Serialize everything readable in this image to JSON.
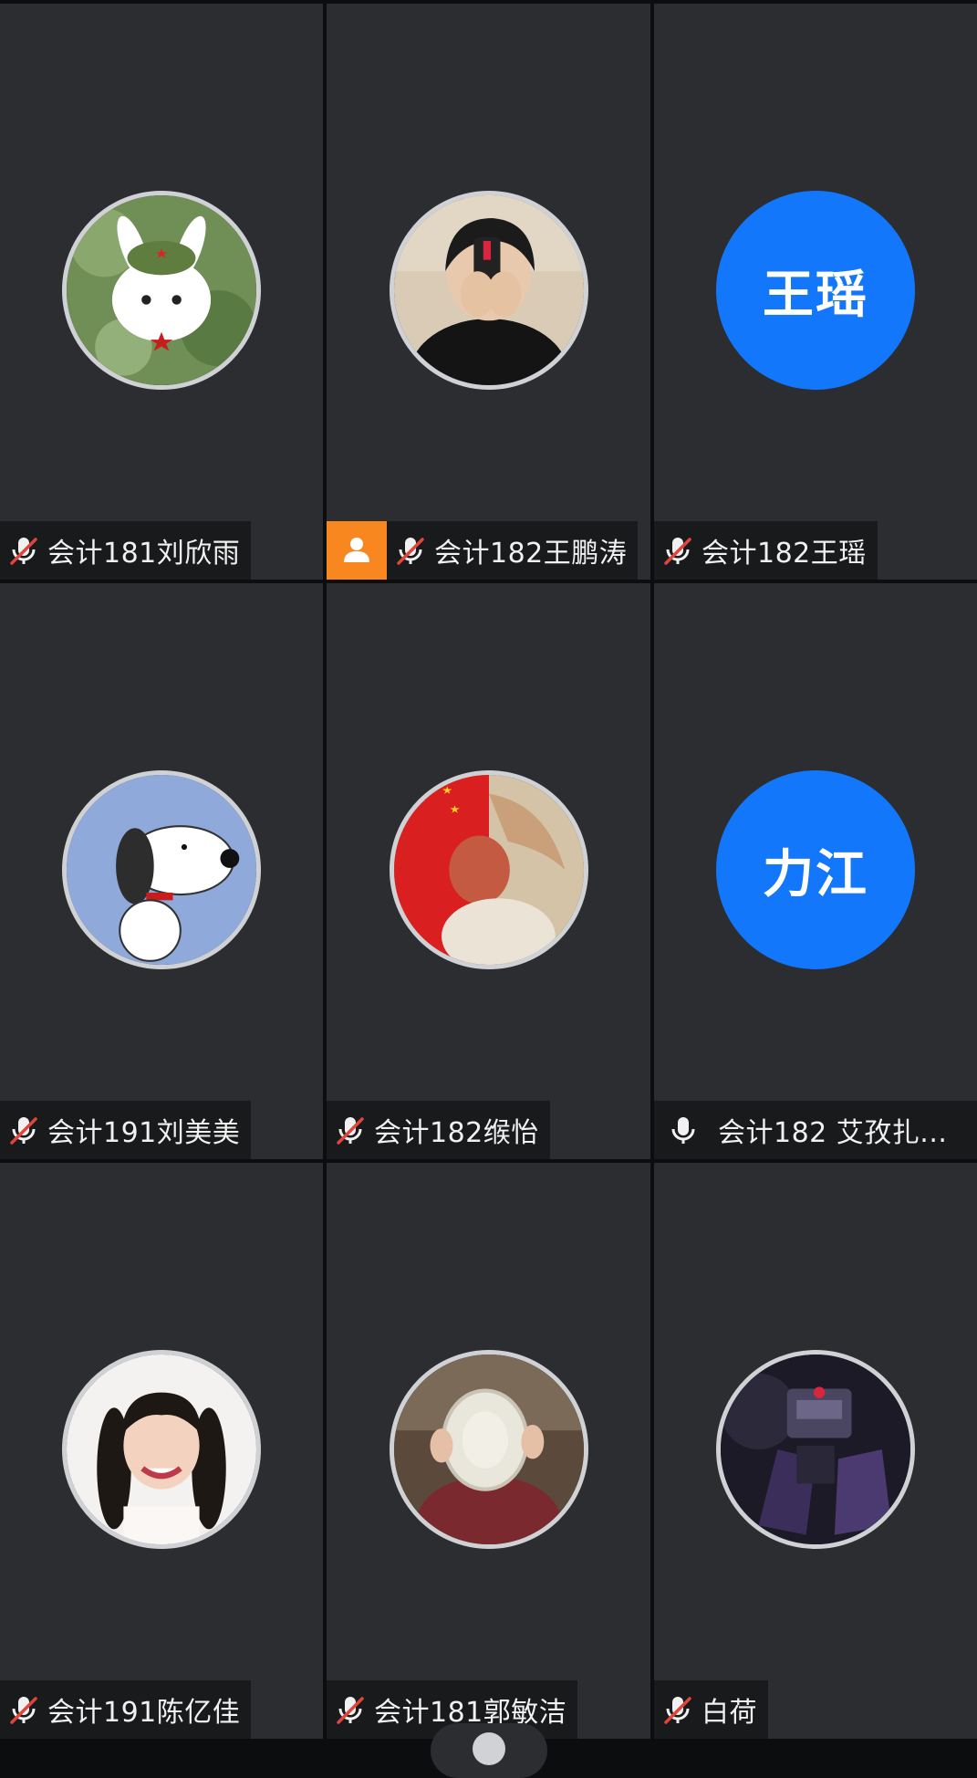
{
  "participants": [
    {
      "name": "会计181刘欣雨",
      "muted": true,
      "avatar": "cartoon-rabbit"
    },
    {
      "name": "会计182王鹏涛",
      "muted": true,
      "avatar": "photo-boy",
      "host": true
    },
    {
      "name": "会计182王瑶",
      "muted": true,
      "avatar_text": "王瑶"
    },
    {
      "name": "会计191刘美美",
      "muted": true,
      "avatar": "snoopy"
    },
    {
      "name": "会计182缑怡",
      "muted": true,
      "avatar": "flag-girl"
    },
    {
      "name": "会计182 艾孜扎...",
      "muted": false,
      "avatar_text": "力江"
    },
    {
      "name": "会计191陈亿佳",
      "muted": true,
      "avatar": "photo-girl"
    },
    {
      "name": "会计181郭敏洁",
      "muted": true,
      "avatar": "child-plate"
    },
    {
      "name": "白荷",
      "muted": true,
      "avatar": "robot"
    }
  ],
  "colors": {
    "tile_bg": "#2b2d31",
    "text_avatar_bg": "#1277fb",
    "host_badge": "#f7871e",
    "mute_slash": "#e0453b"
  }
}
